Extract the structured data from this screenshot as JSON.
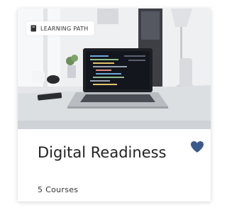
{
  "card": {
    "badge_label": "LEARNING PATH",
    "title": "Digital Readiness",
    "subtitle": "5 Courses",
    "badge_icon": "book-icon",
    "favorite_icon": "heart-icon",
    "favorite_color": "#3a5a8c"
  }
}
